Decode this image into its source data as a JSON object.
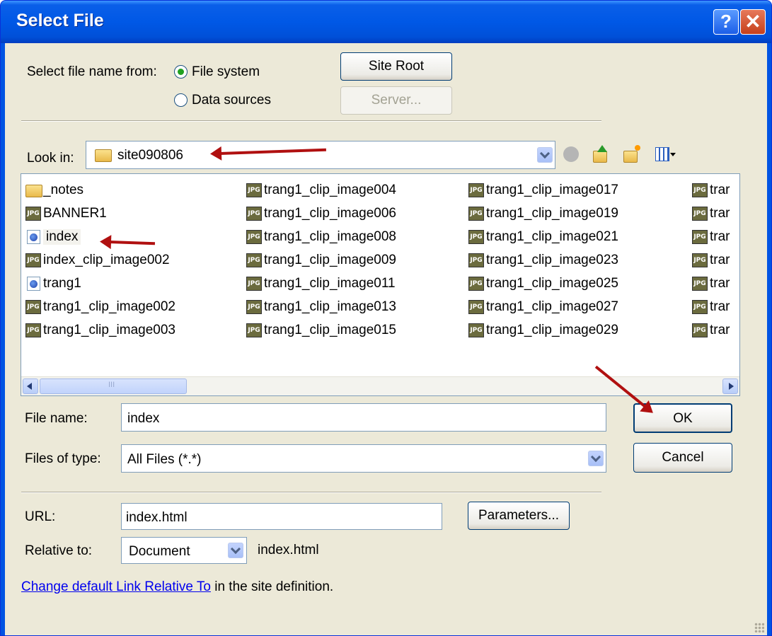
{
  "window": {
    "title": "Select File",
    "help_label": "?",
    "close_label": "✕"
  },
  "source": {
    "label": "Select file name from:",
    "options": [
      {
        "label": "File system",
        "selected": true
      },
      {
        "label": "Data sources",
        "selected": false
      }
    ],
    "site_root_label": "Site Root",
    "server_label": "Server..."
  },
  "look_in": {
    "label": "Look in:",
    "value": "site090806"
  },
  "toolbar_icons": [
    "back-icon",
    "up-folder-icon",
    "new-folder-icon",
    "view-menu-icon"
  ],
  "files": [
    {
      "name": "_notes",
      "type": "folder"
    },
    {
      "name": "BANNER1",
      "type": "jpg"
    },
    {
      "name": "index",
      "type": "html"
    },
    {
      "name": "index_clip_image002",
      "type": "jpg"
    },
    {
      "name": "trang1",
      "type": "html"
    },
    {
      "name": "trang1_clip_image002",
      "type": "jpg"
    },
    {
      "name": "trang1_clip_image003",
      "type": "jpg"
    },
    {
      "name": "trang1_clip_image004",
      "type": "jpg"
    },
    {
      "name": "trang1_clip_image006",
      "type": "jpg"
    },
    {
      "name": "trang1_clip_image008",
      "type": "jpg"
    },
    {
      "name": "trang1_clip_image009",
      "type": "jpg"
    },
    {
      "name": "trang1_clip_image011",
      "type": "jpg"
    },
    {
      "name": "trang1_clip_image013",
      "type": "jpg"
    },
    {
      "name": "trang1_clip_image015",
      "type": "jpg"
    },
    {
      "name": "trang1_clip_image017",
      "type": "jpg"
    },
    {
      "name": "trang1_clip_image019",
      "type": "jpg"
    },
    {
      "name": "trang1_clip_image021",
      "type": "jpg"
    },
    {
      "name": "trang1_clip_image023",
      "type": "jpg"
    },
    {
      "name": "trang1_clip_image025",
      "type": "jpg"
    },
    {
      "name": "trang1_clip_image027",
      "type": "jpg"
    },
    {
      "name": "trang1_clip_image029",
      "type": "jpg"
    },
    {
      "name": "trar",
      "type": "jpg"
    },
    {
      "name": "trar",
      "type": "jpg"
    },
    {
      "name": "trar",
      "type": "jpg"
    },
    {
      "name": "trar",
      "type": "jpg"
    },
    {
      "name": "trar",
      "type": "jpg"
    },
    {
      "name": "trar",
      "type": "jpg"
    },
    {
      "name": "trar",
      "type": "jpg"
    }
  ],
  "selected_file": "index",
  "file_name": {
    "label": "File name:",
    "value": "index"
  },
  "file_type": {
    "label": "Files of type:",
    "value": "All Files (*.*)"
  },
  "ok_label": "OK",
  "cancel_label": "Cancel",
  "url": {
    "label": "URL:",
    "value": "index.html"
  },
  "parameters_label": "Parameters...",
  "relative": {
    "label": "Relative to:",
    "value": "Document",
    "file": "index.html"
  },
  "footer": {
    "link": "Change default Link Relative To",
    "text": " in the site definition."
  },
  "scrollbar_thumb_text": "III"
}
